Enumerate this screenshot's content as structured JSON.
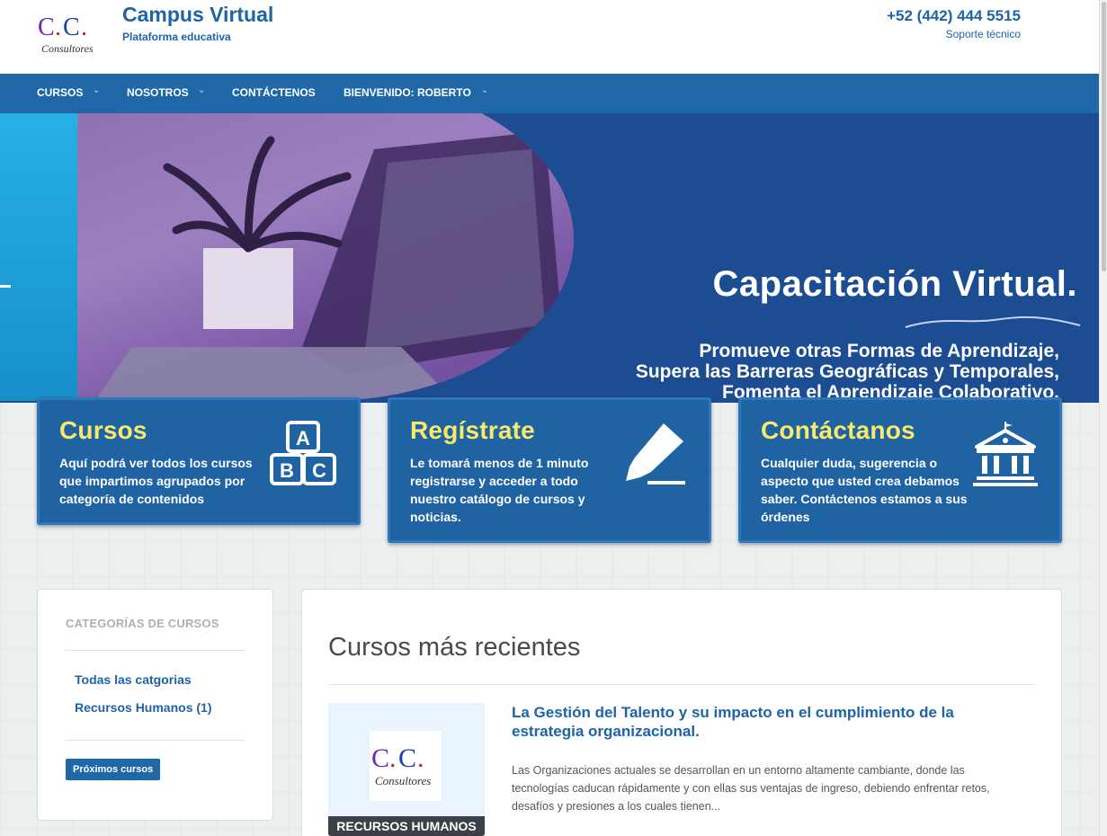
{
  "header": {
    "title": "Campus Virtual",
    "subtitle": "Plataforma educativa",
    "phone": "+52 (442) 444 5515",
    "support": "Soporte técnico",
    "logo_text": "C.C. Consultores"
  },
  "nav": [
    {
      "label": "CURSOS",
      "dropdown": true
    },
    {
      "label": "NOSOTROS",
      "dropdown": true
    },
    {
      "label": "CONTÁCTENOS",
      "dropdown": false
    },
    {
      "label": "BIENVENIDO: ROBERTO",
      "dropdown": true
    }
  ],
  "hero": {
    "title": "Capacitación Virtual.",
    "lines": [
      "Promueve otras Formas de Aprendizaje,",
      "Supera las Barreras Geográficas y Temporales,",
      "Fomenta el Aprendizaje Colaborativo."
    ]
  },
  "cards": [
    {
      "title": "Cursos",
      "text": "Aquí podrá ver todos los cursos que impartimos agrupados por categoría de contenidos",
      "icon": "abc-blocks-icon"
    },
    {
      "title": "Regístrate",
      "text": "Le tomará menos de 1 minuto registrarse y acceder a todo nuestro catálogo de cursos y noticias.",
      "icon": "marker-icon"
    },
    {
      "title": "Contáctanos",
      "text": "Cualquier duda, sugerencia o aspecto que usted crea debamos saber. Contáctenos estamos a sus órdenes",
      "icon": "building-icon"
    }
  ],
  "sidebar": {
    "heading": "CATEGORÍAS DE CURSOS",
    "links": [
      "Todas las catgorias",
      "Recursos Humanos (1)"
    ],
    "button": "Próximos cursos"
  },
  "main": {
    "heading": "Cursos más recientes",
    "course": {
      "category": "RECURSOS HUMANOS",
      "title": "La Gestión del Talento y su impacto en el cumplimiento de la estrategia organizacional.",
      "description": "Las Organizaciones actuales se desarrollan en un entorno altamente cambiante, donde las tecnologías caducan rápidamente y con ellas sus ventajas de ingreso, debiendo enfrentar retos, desafíos y presiones a los cuales tienen..."
    }
  },
  "colors": {
    "brand_blue": "#1f67a7",
    "card_title_yellow": "#f7ea6a",
    "hero_navy": "#1c4c91"
  }
}
